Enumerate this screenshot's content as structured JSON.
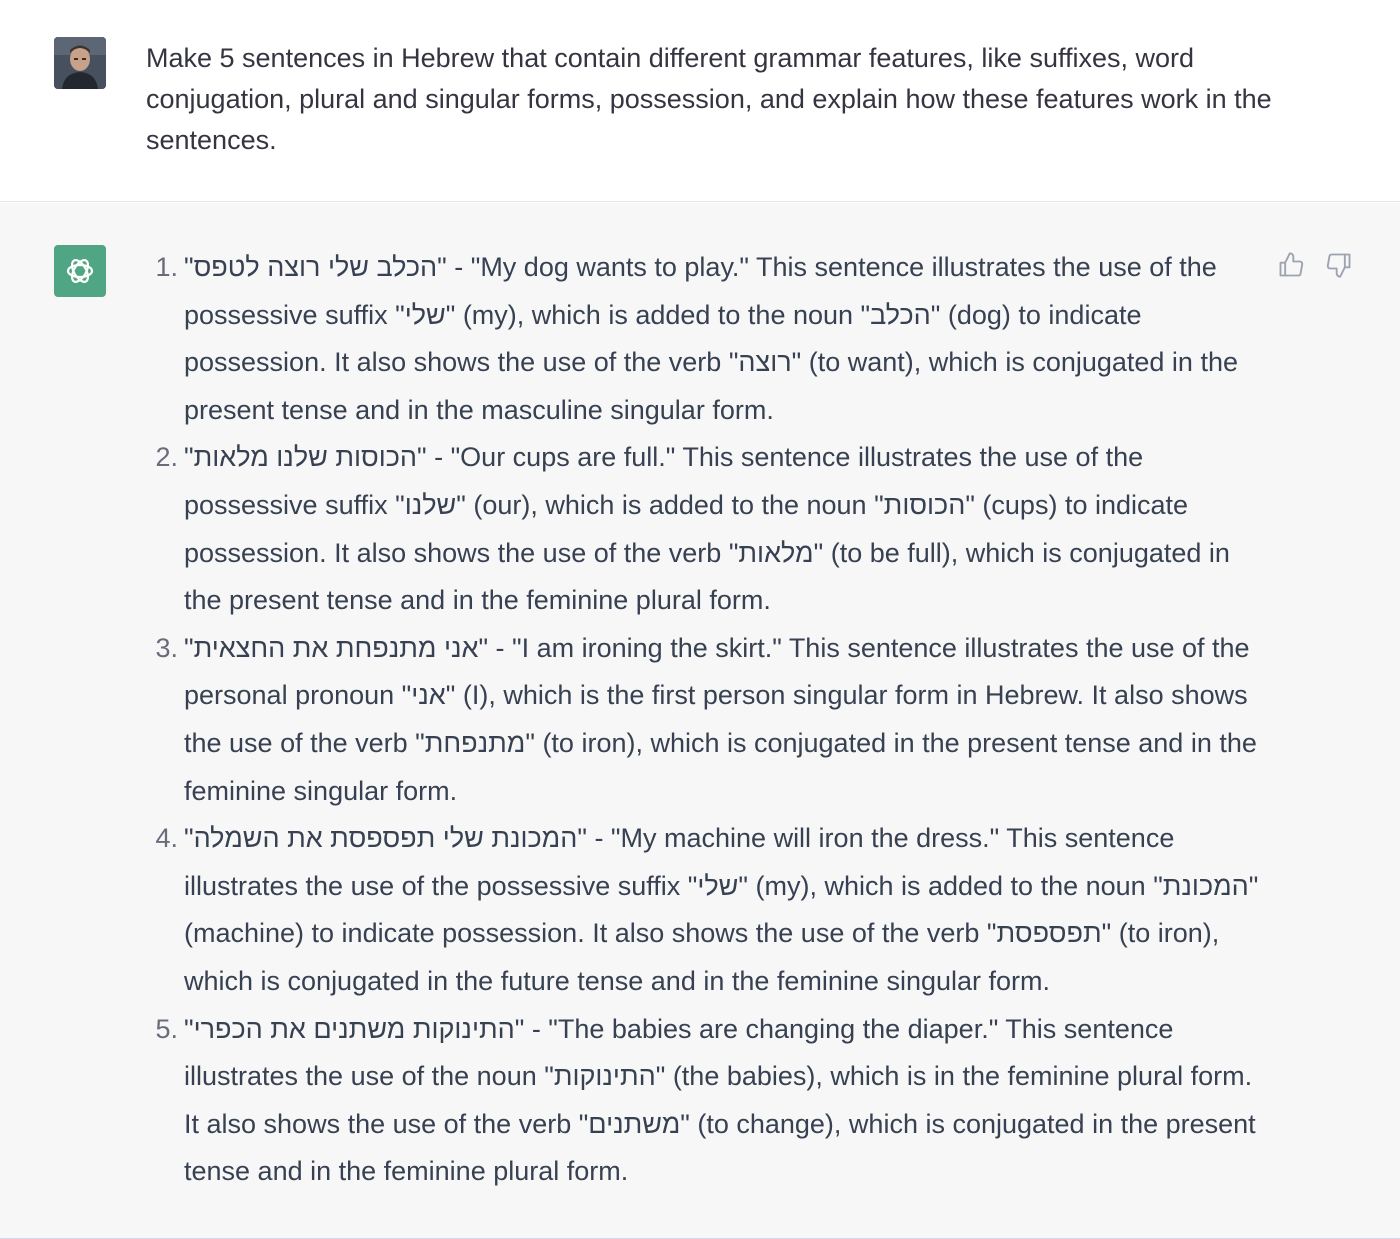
{
  "user": {
    "prompt": "Make 5 sentences in Hebrew that contain different grammar features, like suffixes, word conjugation, plural and singular forms, possession, and explain how these features work in the sentences."
  },
  "assistant": {
    "items": [
      {
        "number": "1.",
        "hebrew_sentence": "\"הכלב שלי רוצה לטפס\"",
        "t1": " - \"My dog wants to play.\" This sentence illustrates the use of the possessive suffix ",
        "w1": "\"שלי\"",
        "t2": " (my), which is added to the noun ",
        "w2": "\"הכלב\"",
        "t3": " (dog) to indicate possession. It also shows the use of the verb ",
        "w3": "\"רוצה\"",
        "t4": " (to want), which is conjugated in the present tense and in the masculine singular form."
      },
      {
        "number": "2.",
        "hebrew_sentence": "\"הכוסות שלנו מלאות\"",
        "t1": " - \"Our cups are full.\" This sentence illustrates the use of the possessive suffix ",
        "w1": "\"שלנו\"",
        "t2": " (our), which is added to the noun ",
        "w2": "\"הכוסות\"",
        "t3": " (cups) to indicate possession. It also shows the use of the verb ",
        "w3": "\"מלאות\"",
        "t4": " (to be full), which is conjugated in the present tense and in the feminine plural form."
      },
      {
        "number": "3.",
        "hebrew_sentence": "\"אני מתנפחת את החצאית\"",
        "t1": " - \"I am ironing the skirt.\" This sentence illustrates the use of the personal pronoun ",
        "w1": "\"אני\"",
        "t2": " (I), which is the first person singular form in Hebrew. It also shows the use of the verb ",
        "w2": "\"מתנפחת\"",
        "t3": " (to iron), which is conjugated in the present tense and in the feminine singular form.",
        "w3": "",
        "t4": ""
      },
      {
        "number": "4.",
        "hebrew_sentence": "\"המכונת שלי תפספסת את השמלה\"",
        "t1": " - \"My machine will iron the dress.\" This sentence illustrates the use of the possessive suffix ",
        "w1": "\"שלי\"",
        "t2": " (my), which is added to the noun ",
        "w2": "\"המכונת\"",
        "t3": " (machine) to indicate possession. It also shows the use of the verb ",
        "w3": "\"תפספסת\"",
        "t4": " (to iron), which is conjugated in the future tense and in the feminine singular form."
      },
      {
        "number": "5.",
        "hebrew_sentence": "\"התינוקות משתנים את הכפרי\"",
        "t1": " - \"The babies are changing the diaper.\" This sentence illustrates the use of the noun ",
        "w1": "\"התינוקות\"",
        "t2": " (the babies), which is in the feminine plural form. It also shows the use of the verb ",
        "w2": "\"משתנים\"",
        "t3": " (to change), which is conjugated in the present tense and in the feminine plural form.",
        "w3": "",
        "t4": ""
      }
    ]
  },
  "icons": {
    "user_avatar": "user-avatar-photo",
    "assistant_logo": "openai-logo-icon",
    "feedback_up": "thumbs-up-icon",
    "feedback_down": "thumbs-down-icon"
  },
  "colors": {
    "assistant_logo_bg": "#4fa584",
    "assistant_bg": "#f7f7f8",
    "text": "#374151"
  }
}
